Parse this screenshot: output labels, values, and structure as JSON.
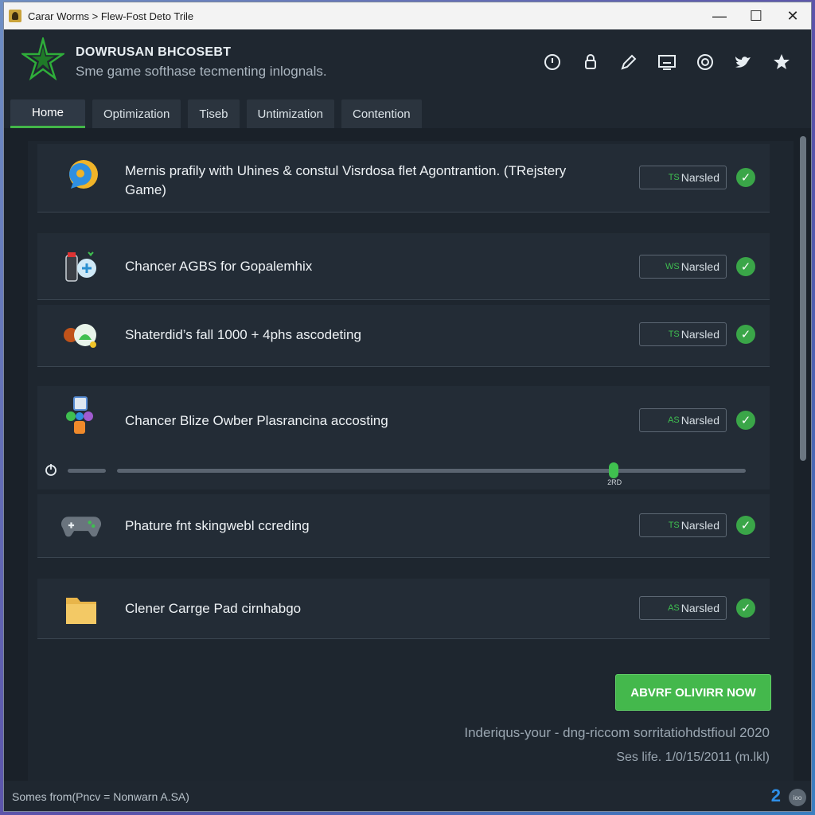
{
  "window": {
    "title": "Carar Worms > Flew-Fost Deto Trile",
    "minimize": "—",
    "maximize": "☐",
    "close": "✕"
  },
  "header": {
    "brand": "DOWRUSAN BHCOSEBT",
    "tagline": "Sme game softhase tecmenting inlognals.",
    "icons": [
      "power-icon",
      "lock-icon",
      "pen-icon",
      "monitor-icon",
      "target-icon",
      "bird-icon",
      "star-icon"
    ]
  },
  "tabs": [
    {
      "label": "Home",
      "active": true
    },
    {
      "label": "Optimization",
      "active": false
    },
    {
      "label": "Tiseb",
      "active": false
    },
    {
      "label": "Untimization",
      "active": false
    },
    {
      "label": "Contention",
      "active": false
    }
  ],
  "rows": [
    {
      "text": "Mernis prafily with Uhines & constul Visrdosa flet Agontrantion. (TRejstery Game)",
      "badge_tag": "TS",
      "badge": "Narsled",
      "icon": "chat-bubble-icon"
    },
    {
      "text": "Chancer AGBS for Gopalemhix",
      "badge_tag": "WS",
      "badge": "Narsled",
      "icon": "spray-bottle-icon"
    },
    {
      "text": "Shaterdid’s fall 1000 + 4phs ascodeting",
      "badge_tag": "TS",
      "badge": "Narsled",
      "icon": "gamepad-bubble-icon"
    },
    {
      "text": "Chancer Blize Owber Plasrancina accosting",
      "badge_tag": "AS",
      "badge": "Narsled",
      "icon": "puzzle-blocks-icon"
    },
    {
      "text": "Phature fnt skingwebl ccreding",
      "badge_tag": "TS",
      "badge": "Narsled",
      "icon": "controller-icon"
    },
    {
      "text": "Clener Carrge Pad cirnhabgo",
      "badge_tag": "AS",
      "badge": "Narsled",
      "icon": "folder-icon"
    }
  ],
  "slider": {
    "value_label": "2RD",
    "fraction": 0.79
  },
  "cta": {
    "label": "ABVRF OLIVIRR NOW"
  },
  "footer": {
    "line1": "Inderiqus-your - dng-riccom sorritatiohdstfioul 2020",
    "line2": "Ses life. 1/0/15/2011 (m.lkl)"
  },
  "status": {
    "text": "Somes from(Pncv = Nonwarn A.SA)",
    "number": "2",
    "dot_label": "ioo"
  },
  "colors": {
    "accent_green": "#43b649",
    "badge_tag_green": "#3fbf50",
    "status_blue": "#2e8fe8"
  }
}
